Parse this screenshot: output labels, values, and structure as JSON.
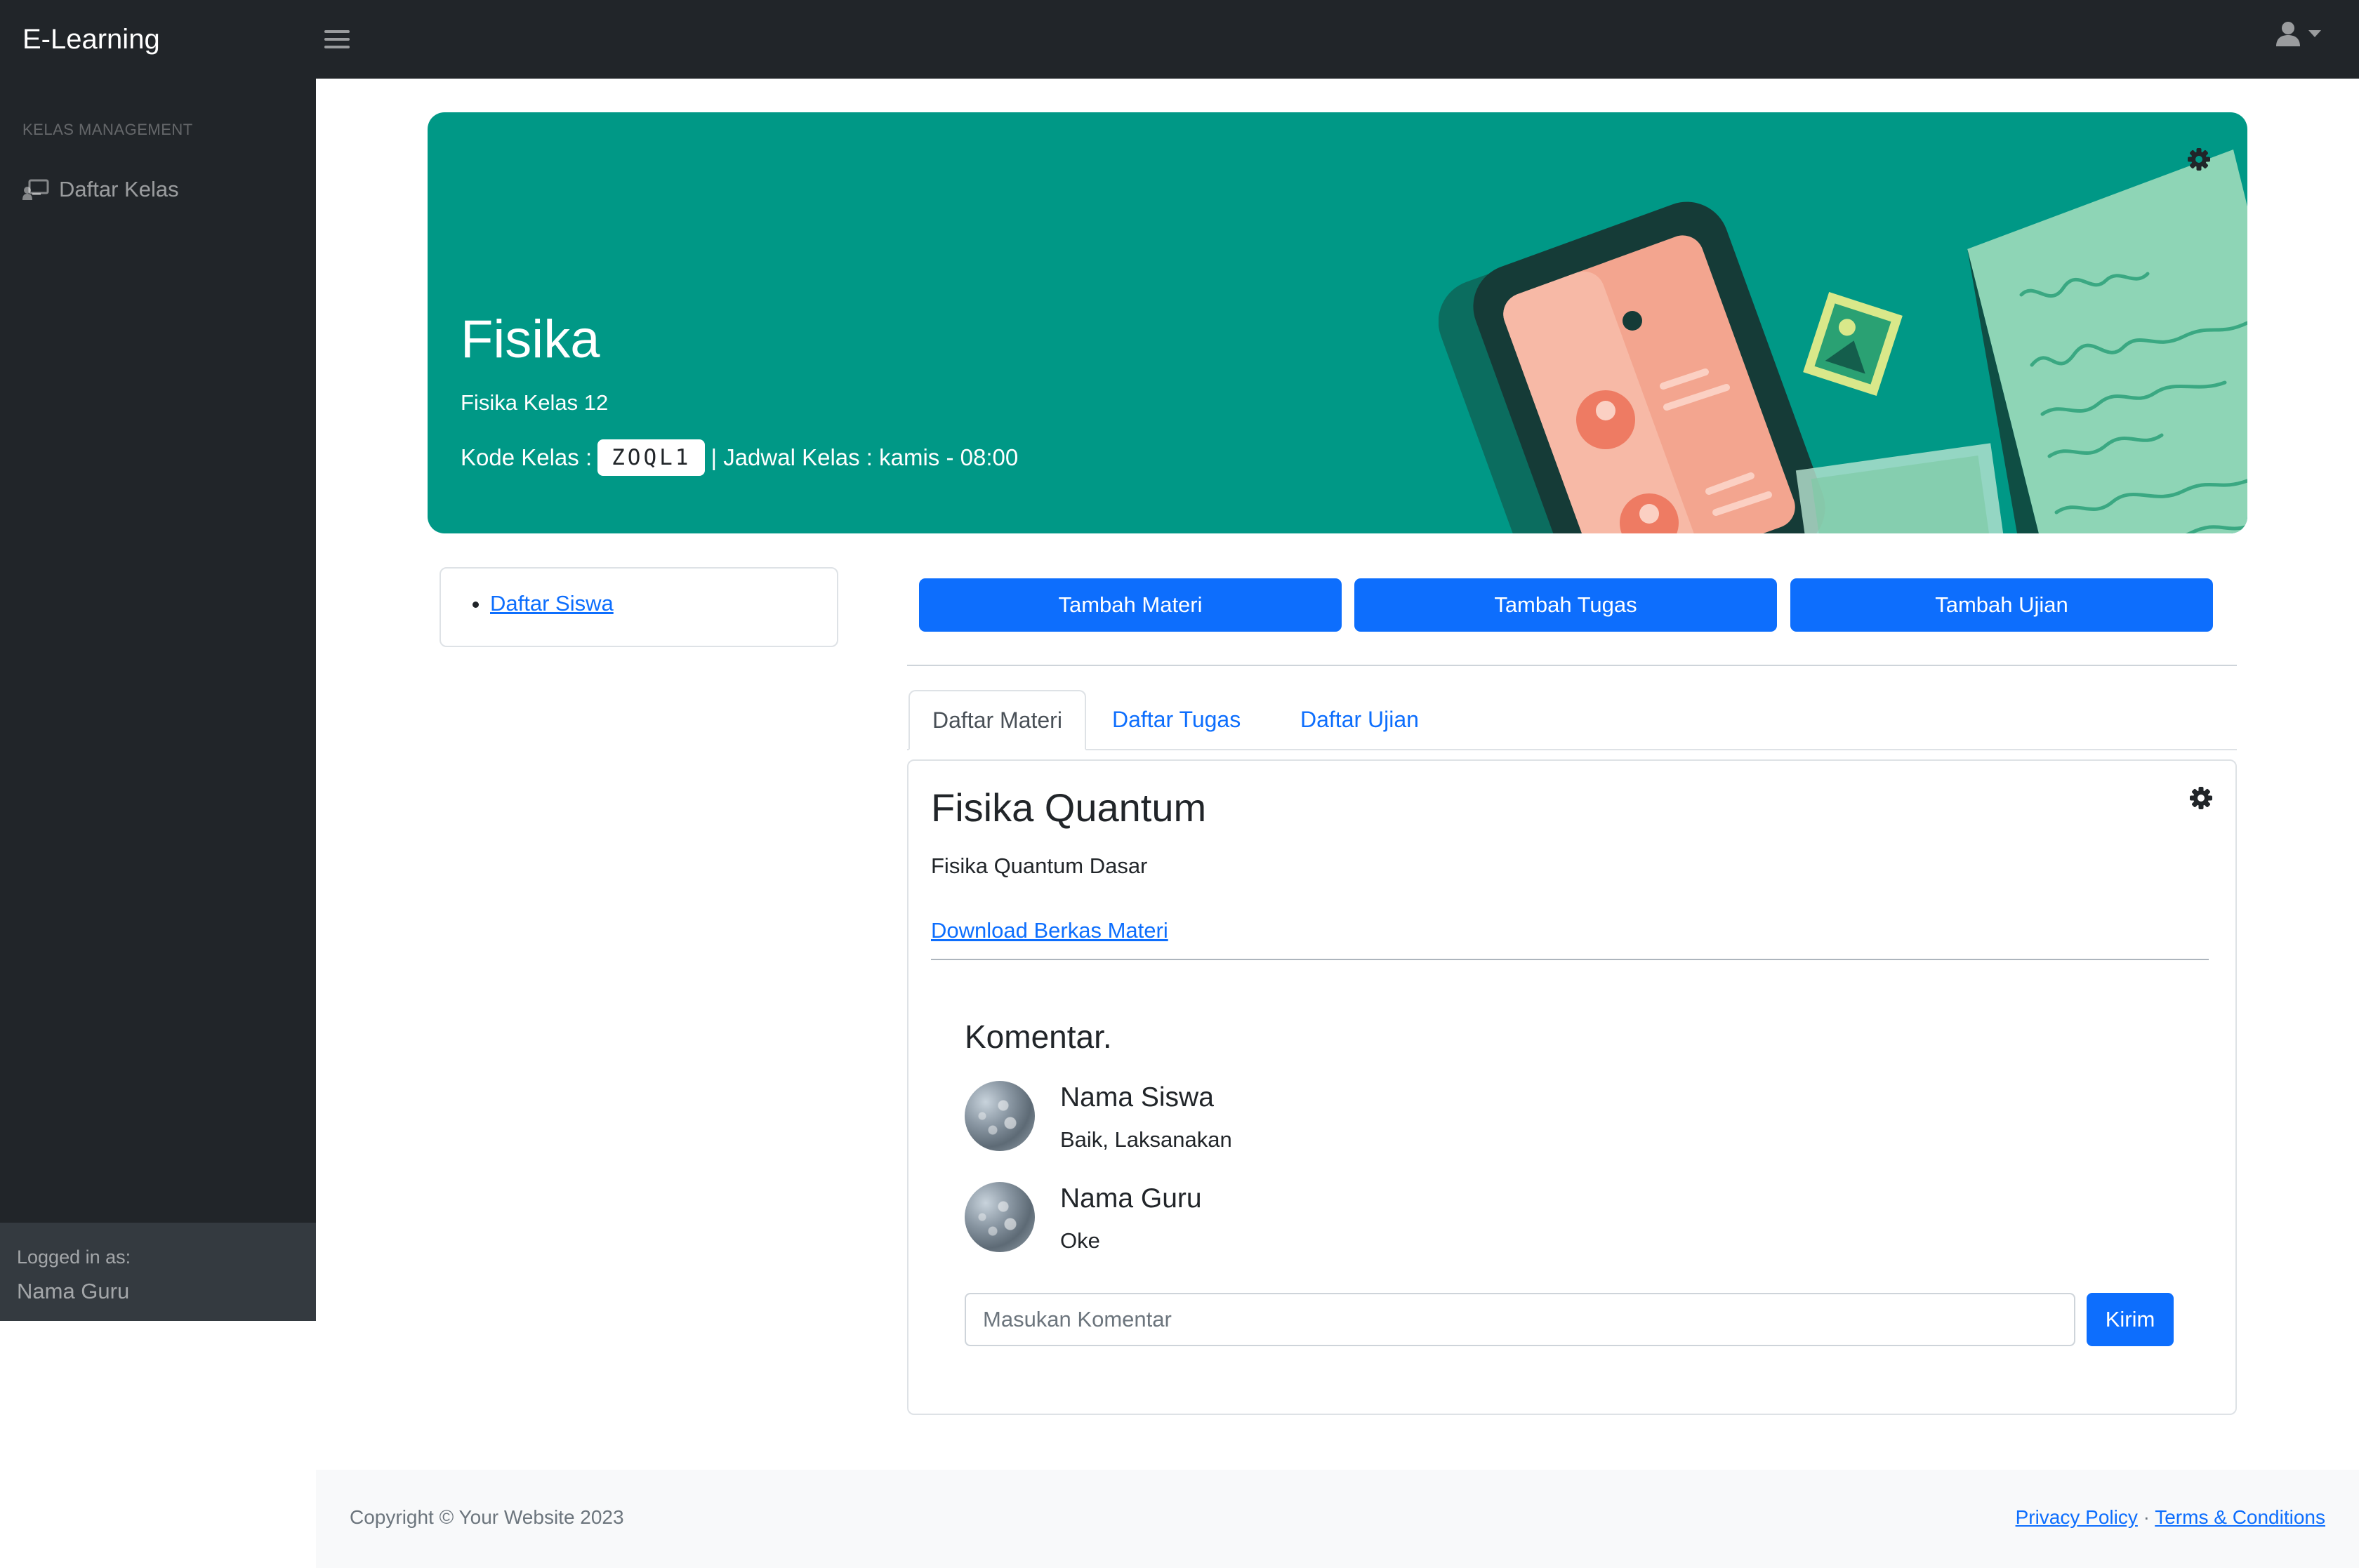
{
  "app": {
    "brand": "E-Learning"
  },
  "sidebar": {
    "heading": "KELAS MANAGEMENT",
    "items": [
      {
        "label": "Daftar Kelas",
        "icon": "chalkboard-teacher-icon"
      }
    ],
    "footer": {
      "label": "Logged in as:",
      "name": "Nama Guru"
    }
  },
  "banner": {
    "title": "Fisika",
    "subtitle": "Fisika Kelas 12",
    "code_label": "Kode Kelas :",
    "code": "ZOQL1",
    "schedule": "| Jadwal Kelas : kamis - 08:00",
    "bg_color": "#009886"
  },
  "left_card": {
    "links": [
      "Daftar Siswa"
    ]
  },
  "actions": {
    "add_material": "Tambah Materi",
    "add_assignment": "Tambah Tugas",
    "add_exam": "Tambah Ujian"
  },
  "tabs": [
    {
      "label": "Daftar Materi",
      "active": true
    },
    {
      "label": "Daftar Tugas",
      "active": false
    },
    {
      "label": "Daftar Ujian",
      "active": false
    }
  ],
  "material": {
    "title": "Fisika Quantum",
    "description": "Fisika Quantum Dasar",
    "download_label": "Download Berkas Materi"
  },
  "comments": {
    "title": "Komentar.",
    "items": [
      {
        "name": "Nama Siswa",
        "text": "Baik, Laksanakan"
      },
      {
        "name": "Nama Guru",
        "text": "Oke"
      }
    ],
    "input_placeholder": "Masukan Komentar",
    "submit_label": "Kirim"
  },
  "footer": {
    "copyright": "Copyright © Your Website 2023",
    "privacy": "Privacy Policy",
    "separator": "·",
    "terms": "Terms & Conditions"
  },
  "colors": {
    "primary": "#0d6efd",
    "dark": "#212529",
    "teal": "#009886"
  }
}
